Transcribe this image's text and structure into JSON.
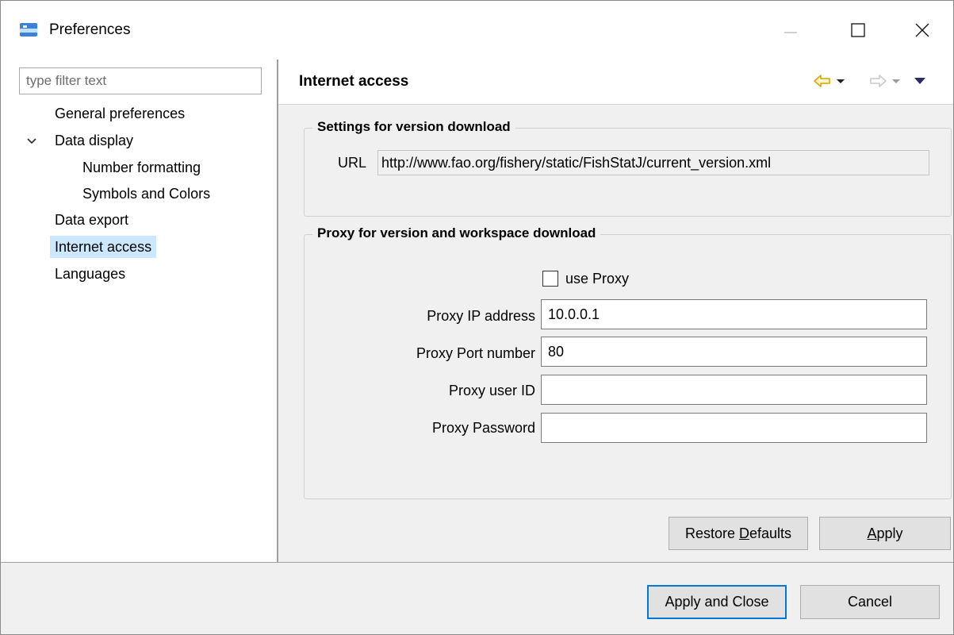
{
  "window": {
    "title": "Preferences",
    "minimize_icon": "minimize-icon",
    "maximize_icon": "maximize-icon",
    "close_icon": "close-icon"
  },
  "sidebar": {
    "filter_placeholder": "type filter text",
    "filter_value": "",
    "items": [
      {
        "label": "General preferences",
        "selected": false
      },
      {
        "label": "Data display",
        "expanded": true,
        "selected": false
      },
      {
        "label": "Number formatting",
        "selected": false
      },
      {
        "label": "Symbols and Colors",
        "selected": false
      },
      {
        "label": "Data export",
        "selected": false
      },
      {
        "label": "Internet access",
        "selected": true
      },
      {
        "label": "Languages",
        "selected": false
      }
    ]
  },
  "page": {
    "title": "Internet access",
    "nav_icons": [
      "back-arrow-icon",
      "back-dropdown-icon",
      "forward-arrow-icon",
      "forward-dropdown-icon",
      "view-menu-icon"
    ],
    "version_group": {
      "title": "Settings for version download",
      "url_label": "URL",
      "url_value": "http://www.fao.org/fishery/static/FishStatJ/current_version.xml"
    },
    "proxy_group": {
      "title": "Proxy for version and workspace download",
      "use_proxy_label": "use Proxy",
      "use_proxy_checked": false,
      "ip_label": "Proxy IP address",
      "ip_value": "10.0.0.1",
      "port_label": "Proxy Port number",
      "port_value": "80",
      "user_label": "Proxy user ID",
      "user_value": "",
      "password_label": "Proxy Password",
      "password_value": ""
    },
    "restore_defaults_prefix": "Restore ",
    "restore_defaults_mnemonic": "D",
    "restore_defaults_suffix": "efaults",
    "apply_mnemonic": "A",
    "apply_suffix": "pply"
  },
  "footer": {
    "apply_close_label": "Apply and Close",
    "cancel_label": "Cancel"
  },
  "colors": {
    "selection": "#cce8ff",
    "default_button_border": "#0078d7",
    "back_arrow": "#e0a000"
  }
}
